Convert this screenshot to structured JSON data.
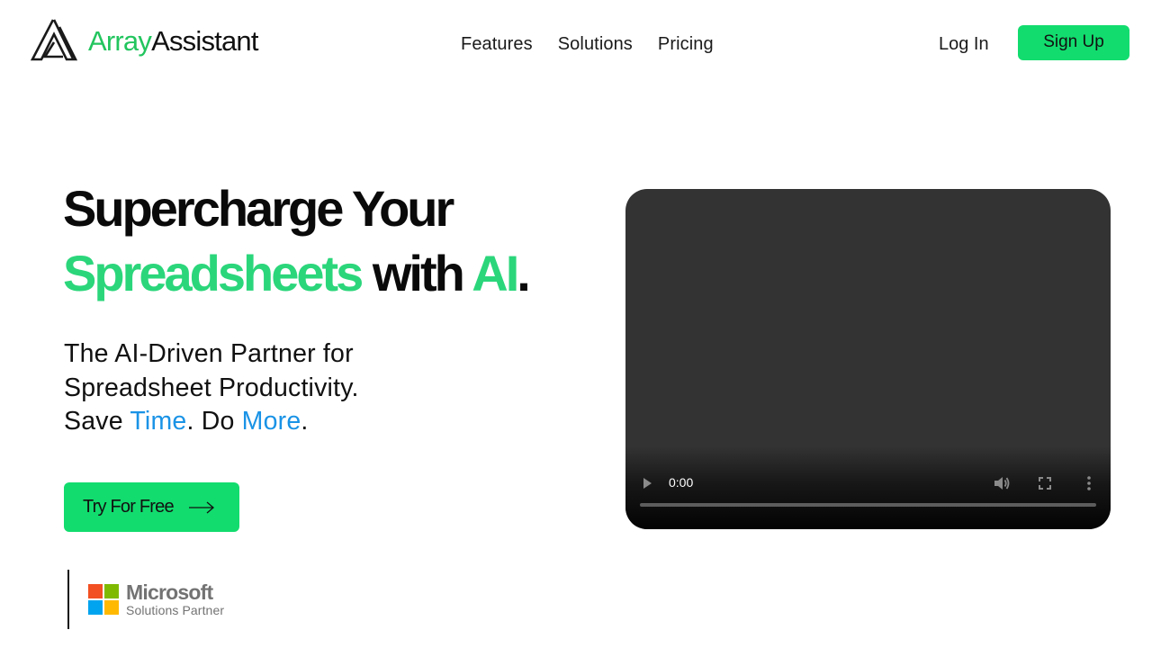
{
  "header": {
    "logo": {
      "part1": "Array",
      "part2": "Assistant",
      "icon": "triangle-a-logo-icon"
    },
    "nav": [
      {
        "label": "Features"
      },
      {
        "label": "Solutions"
      },
      {
        "label": "Pricing"
      }
    ],
    "login_label": "Log In",
    "signup_label": "Sign Up"
  },
  "hero": {
    "headline": {
      "line1": "Supercharge Your",
      "green1": "Spreadsheets",
      "mid": " with ",
      "green2": "AI",
      "end": "."
    },
    "subhead": {
      "line1": "The AI-Driven Partner for",
      "line2": "Spreadsheet Productivity.",
      "save": "Save ",
      "time": "Time",
      "do": ". Do ",
      "more": "More",
      "end": "."
    },
    "cta_label": "Try For Free",
    "cta_icon": "arrow-right-icon",
    "partner": {
      "title": "Microsoft",
      "subtitle": "Solutions Partner"
    }
  },
  "video": {
    "current_time": "0:00",
    "progress": 0,
    "icons": [
      "play-icon",
      "volume-icon",
      "fullscreen-icon",
      "more-options-icon"
    ]
  },
  "colors": {
    "brand_green": "#12dc6e",
    "headline_green": "#2bd67b",
    "accent_blue": "#1a93e6",
    "video_bg": "#333333"
  }
}
